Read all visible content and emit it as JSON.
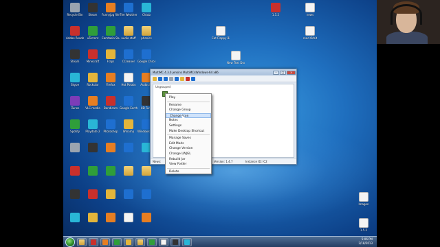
{
  "desktop": {
    "icons": [
      {
        "label": "Recycle Bin",
        "color": "g-gray"
      },
      {
        "label": "Steam",
        "color": "g-dark"
      },
      {
        "label": "Funnyjpg files",
        "color": "g-orange"
      },
      {
        "label": "The Weather Channel App",
        "color": "g-blue"
      },
      {
        "label": "Chtub",
        "color": "g-cyan"
      },
      {
        "label": "Adobe Reader X",
        "color": "g-red"
      },
      {
        "label": "uTorrent",
        "color": "g-green"
      },
      {
        "label": "Camtasia Studio 8",
        "color": "g-green"
      },
      {
        "label": "audio stuff",
        "color": "g-folder"
      },
      {
        "label": "phonics",
        "color": "g-folder"
      },
      {
        "label": "Steam",
        "color": "g-dark"
      },
      {
        "label": "Minecraft",
        "color": "g-red"
      },
      {
        "label": "Fraps",
        "color": "g-yellow"
      },
      {
        "label": "CCleaner",
        "color": "g-blue"
      },
      {
        "label": "Google Chrome",
        "color": "g-blue"
      },
      {
        "label": "Skype",
        "color": "g-cyan"
      },
      {
        "label": "Rockstar",
        "color": "g-yellow"
      },
      {
        "label": "Firefox",
        "color": "g-orange"
      },
      {
        "label": "Hot Potato",
        "color": "g-doc"
      },
      {
        "label": "Audacity",
        "color": "g-orange"
      },
      {
        "label": "iTunes",
        "color": "g-purple"
      },
      {
        "label": "VLC media",
        "color": "g-orange"
      },
      {
        "label": "Bandicam",
        "color": "g-red"
      },
      {
        "label": "Google Earth",
        "color": "g-blue"
      },
      {
        "label": "HD Tune",
        "color": "g-dark"
      },
      {
        "label": "Spotify",
        "color": "g-green"
      },
      {
        "label": "Playdate 2",
        "color": "g-cyan"
      },
      {
        "label": "Photoshop",
        "color": "g-blue"
      },
      {
        "label": "Winamp",
        "color": "g-yellow"
      },
      {
        "label": "Windows Live",
        "color": "g-blue"
      }
    ],
    "right_icons": [
      {
        "label": "1.5.2"
      },
      {
        "label": "news"
      },
      {
        "label": "Cat Flappy Bird"
      },
      {
        "label": "read Orbit"
      },
      {
        "label": "New Text Document"
      },
      {
        "label": "Imagen"
      },
      {
        "label": "1.5.2"
      }
    ]
  },
  "window": {
    "title": "MultiMC 4.3.0 jenkins MultiMC4Windows-64 x86",
    "minimize": "–",
    "maximize": "□",
    "close": "x",
    "group_header": "Ungrouped",
    "status_news": "News:",
    "status_version": "Version: 1.4.7",
    "status_instance_id": "Instance ID: IC2"
  },
  "context_menu": {
    "items": [
      "Play",
      "Rename",
      "Change Group",
      "Change Icon",
      "Notes",
      "Settings",
      "Make Desktop Shortcut",
      "Manage Saves",
      "Edit Mods",
      "Change Version",
      "Change LWJGL",
      "Rebuild Jar",
      "View Folder",
      "Delete"
    ],
    "highlighted": "Change Icon"
  },
  "taskbar": {
    "clock_time": "5:06 PM",
    "clock_date": "2/18/2013",
    "apps": [
      "windows-explorer",
      "chrome",
      "media-player",
      "minecraft",
      "multimc",
      "folder",
      "camtasia",
      "notepad",
      "vlc",
      "skype"
    ]
  }
}
